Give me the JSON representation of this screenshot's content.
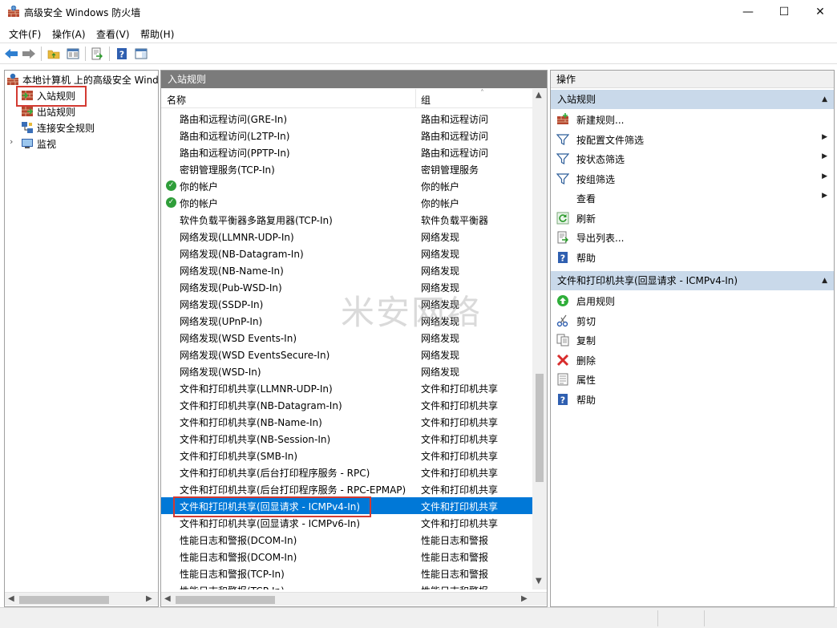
{
  "window": {
    "title": "高级安全 Windows 防火墙",
    "controls": {
      "minimize": "—",
      "maximize": "☐",
      "close": "✕"
    }
  },
  "menu": [
    {
      "label": "文件(F)"
    },
    {
      "label": "操作(A)"
    },
    {
      "label": "查看(V)"
    },
    {
      "label": "帮助(H)"
    }
  ],
  "toolbar": {
    "icons": [
      "back-arrow-icon",
      "forward-arrow-icon",
      "up-folder-icon",
      "show-hide-console-tree-icon",
      "export-list-icon",
      "help-icon",
      "show-hide-action-pane-icon"
    ]
  },
  "tree": {
    "root": "本地计算机 上的高级安全 Windows 防火墙",
    "items": [
      {
        "label": "入站规则"
      },
      {
        "label": "出站规则"
      },
      {
        "label": "连接安全规则"
      },
      {
        "label": "监视"
      }
    ],
    "expander": "›"
  },
  "list": {
    "header": "入站规则",
    "columns": {
      "name": "名称",
      "group": "组"
    },
    "sort_indicator": "˄",
    "rows": [
      {
        "name": "路由和远程访问(GRE-In)",
        "group": "路由和远程访问"
      },
      {
        "name": "路由和远程访问(L2TP-In)",
        "group": "路由和远程访问"
      },
      {
        "name": "路由和远程访问(PPTP-In)",
        "group": "路由和远程访问"
      },
      {
        "name": "密钥管理服务(TCP-In)",
        "group": "密钥管理服务"
      },
      {
        "name": "你的帐户",
        "group": "你的帐户",
        "enabled": true
      },
      {
        "name": "你的帐户",
        "group": "你的帐户",
        "enabled": true
      },
      {
        "name": "软件负载平衡器多路复用器(TCP-In)",
        "group": "软件负载平衡器"
      },
      {
        "name": "网络发现(LLMNR-UDP-In)",
        "group": "网络发现"
      },
      {
        "name": "网络发现(NB-Datagram-In)",
        "group": "网络发现"
      },
      {
        "name": "网络发现(NB-Name-In)",
        "group": "网络发现"
      },
      {
        "name": "网络发现(Pub-WSD-In)",
        "group": "网络发现"
      },
      {
        "name": "网络发现(SSDP-In)",
        "group": "网络发现"
      },
      {
        "name": "网络发现(UPnP-In)",
        "group": "网络发现"
      },
      {
        "name": "网络发现(WSD Events-In)",
        "group": "网络发现"
      },
      {
        "name": "网络发现(WSD EventsSecure-In)",
        "group": "网络发现"
      },
      {
        "name": "网络发现(WSD-In)",
        "group": "网络发现"
      },
      {
        "name": "文件和打印机共享(LLMNR-UDP-In)",
        "group": "文件和打印机共享"
      },
      {
        "name": "文件和打印机共享(NB-Datagram-In)",
        "group": "文件和打印机共享"
      },
      {
        "name": "文件和打印机共享(NB-Name-In)",
        "group": "文件和打印机共享"
      },
      {
        "name": "文件和打印机共享(NB-Session-In)",
        "group": "文件和打印机共享"
      },
      {
        "name": "文件和打印机共享(SMB-In)",
        "group": "文件和打印机共享"
      },
      {
        "name": "文件和打印机共享(后台打印程序服务 - RPC)",
        "group": "文件和打印机共享"
      },
      {
        "name": "文件和打印机共享(后台打印程序服务 - RPC-EPMAP)",
        "group": "文件和打印机共享"
      },
      {
        "name": "文件和打印机共享(回显请求 - ICMPv4-In)",
        "group": "文件和打印机共享",
        "selected": true
      },
      {
        "name": "文件和打印机共享(回显请求 - ICMPv6-In)",
        "group": "文件和打印机共享"
      },
      {
        "name": "性能日志和警报(DCOM-In)",
        "group": "性能日志和警报"
      },
      {
        "name": "性能日志和警报(DCOM-In)",
        "group": "性能日志和警报"
      },
      {
        "name": "性能日志和警报(TCP-In)",
        "group": "性能日志和警报"
      },
      {
        "name": "性能日志和警报(TCP-In)",
        "group": "性能日志和警报"
      }
    ]
  },
  "actions": {
    "title": "操作",
    "section1": {
      "title": "入站规则",
      "items": [
        {
          "label": "新建规则...",
          "icon": "new-rule-icon"
        },
        {
          "label": "按配置文件筛选",
          "icon": "filter-icon",
          "submenu": true
        },
        {
          "label": "按状态筛选",
          "icon": "filter-icon",
          "submenu": true
        },
        {
          "label": "按组筛选",
          "icon": "filter-icon",
          "submenu": true
        },
        {
          "label": "查看",
          "icon": "",
          "submenu": true
        },
        {
          "label": "刷新",
          "icon": "refresh-icon"
        },
        {
          "label": "导出列表...",
          "icon": "export-list-icon"
        },
        {
          "label": "帮助",
          "icon": "help-icon"
        }
      ]
    },
    "section2": {
      "title": "文件和打印机共享(回显请求 - ICMPv4-In)",
      "items": [
        {
          "label": "启用规则",
          "icon": "enable-rule-icon"
        },
        {
          "label": "剪切",
          "icon": "cut-icon"
        },
        {
          "label": "复制",
          "icon": "copy-icon"
        },
        {
          "label": "删除",
          "icon": "delete-icon"
        },
        {
          "label": "属性",
          "icon": "properties-icon"
        },
        {
          "label": "帮助",
          "icon": "help-icon"
        }
      ]
    },
    "collapse_glyph": "▲",
    "submenu_glyph": "▶"
  },
  "watermark": "米安网络",
  "colors": {
    "selection": "#0078d7",
    "section_header": "#c9d9ea",
    "pane_header": "#7b7b7b",
    "highlight_box": "#d33a32"
  }
}
